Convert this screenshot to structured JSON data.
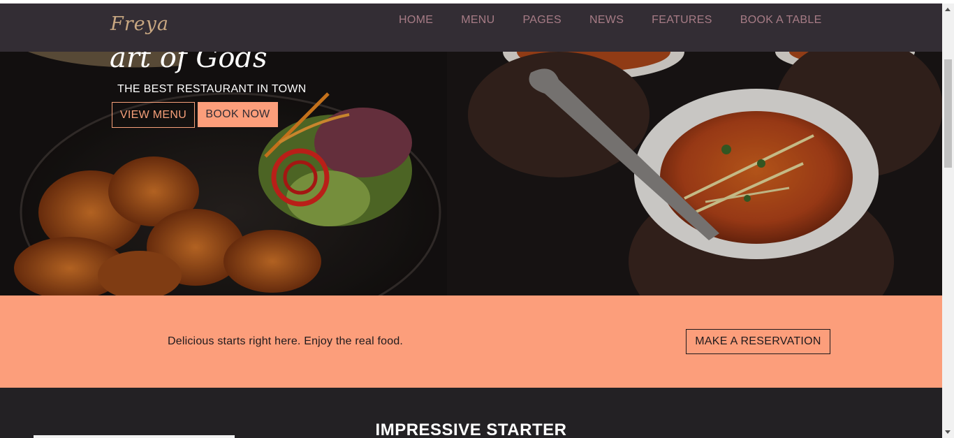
{
  "header": {
    "logo": "Freya",
    "nav": [
      "HOME",
      "MENU",
      "PAGES",
      "NEWS",
      "FEATURES",
      "BOOK A TABLE"
    ]
  },
  "hero": {
    "title": "art of Gods",
    "subtitle": "THE BEST RESTAURANT IN TOWN",
    "view_menu": "VIEW MENU",
    "book_now": "BOOK NOW"
  },
  "promo": {
    "text": "Delicious starts right here. Enjoy the real food.",
    "button": "MAKE A RESERVATION"
  },
  "starter": {
    "title": "IMPRESSIVE STARTER"
  },
  "colors": {
    "header_bg": "#332d34",
    "accent": "#fc9e7b",
    "nav_text": "#a77c86",
    "logo": "#c9a882",
    "dark_section": "#232124"
  }
}
